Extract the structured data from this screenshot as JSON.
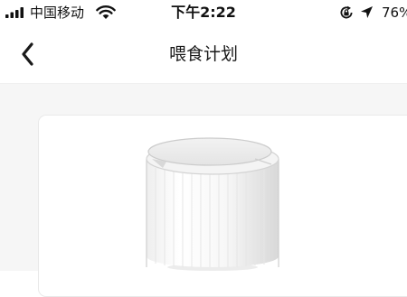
{
  "status_bar": {
    "carrier": "中国移动",
    "time": "下午2:22",
    "battery": "76%"
  },
  "nav": {
    "title": "喂食计划"
  },
  "icons": {
    "signal": "cellular-signal-icon",
    "wifi": "wifi-icon",
    "rotation_lock": "rotation-lock-icon",
    "location": "location-arrow-icon",
    "back": "back-chevron-icon"
  },
  "content": {
    "product_image": "pet-feeder-image"
  },
  "colors": {
    "background": "#f6f6f6",
    "card": "#ffffff",
    "text": "#111111"
  }
}
